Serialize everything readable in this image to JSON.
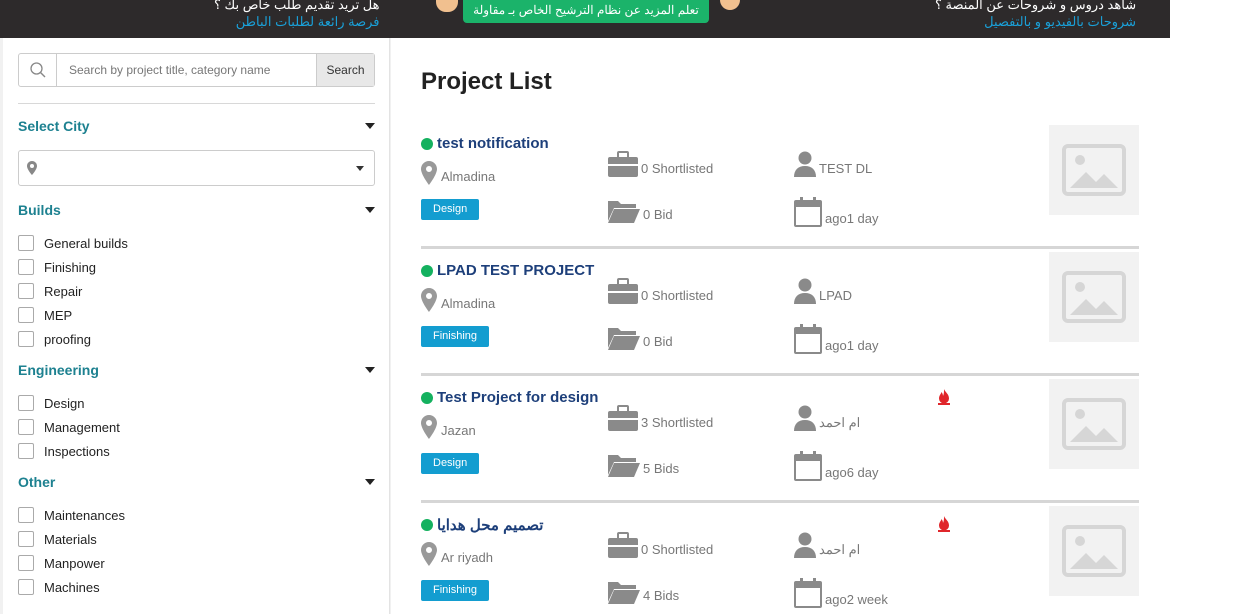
{
  "banner": {
    "left_line1": "هل تريد تقديم طلب خاص بك ؟",
    "left_line2": "فرصة رائعة لطلبات الباطن",
    "button_label": "تعلم المزيد عن نظام الترشيح الخاص بـ مقاولة",
    "right_line1": "شاهد دروس و شروحات عن المنصة ؟",
    "right_line2": "شروحات بالفيديو و بالتفصيل"
  },
  "sidebar": {
    "search": {
      "placeholder": "Search by project title, category name",
      "value": "",
      "button_label": "Search",
      "icon": "search-icon"
    },
    "city": {
      "title": "Select City",
      "value": "",
      "icon": "map-pin-icon"
    },
    "groups": [
      {
        "title": "Builds",
        "items": [
          "General builds",
          "Finishing",
          "Repair",
          "MEP",
          "proofing"
        ]
      },
      {
        "title": "Engineering",
        "items": [
          "Design",
          "Management",
          "Inspections"
        ]
      },
      {
        "title": "Other",
        "items": [
          "Maintenances",
          "Materials",
          "Manpower",
          "Machines"
        ]
      }
    ]
  },
  "main": {
    "title": "Project List",
    "projects": [
      {
        "title": "test notification",
        "location": "Almadina",
        "shortlisted": "0 Shortlisted",
        "owner": "TEST DL",
        "category": "Design",
        "bids": "0 Bid",
        "time": "ago1 day",
        "hot": false
      },
      {
        "title": "LPAD TEST PROJECT",
        "location": "Almadina",
        "shortlisted": "0 Shortlisted",
        "owner": "LPAD",
        "category": "Finishing",
        "bids": "0 Bid",
        "time": "ago1 day",
        "hot": false
      },
      {
        "title": "Test Project for design",
        "location": "Jazan",
        "shortlisted": "3 Shortlisted",
        "owner": "ام احمد",
        "category": "Design",
        "bids": "5 Bids",
        "time": "ago6 day",
        "hot": true
      },
      {
        "title": "تصميم محل هدايا",
        "location": "Ar riyadh",
        "shortlisted": "0 Shortlisted",
        "owner": "ام احمد",
        "category": "Finishing",
        "bids": "4 Bids",
        "time": "ago2 week",
        "hot": true
      }
    ]
  },
  "colors": {
    "accent_teal": "#1d8190",
    "title_navy": "#1d3f7a",
    "status_green": "#14b15f",
    "tag_blue": "#139dd0",
    "banner_bg": "#2d2a2b",
    "banner_button": "#1bb36a",
    "hot_red": "#e0262b"
  }
}
